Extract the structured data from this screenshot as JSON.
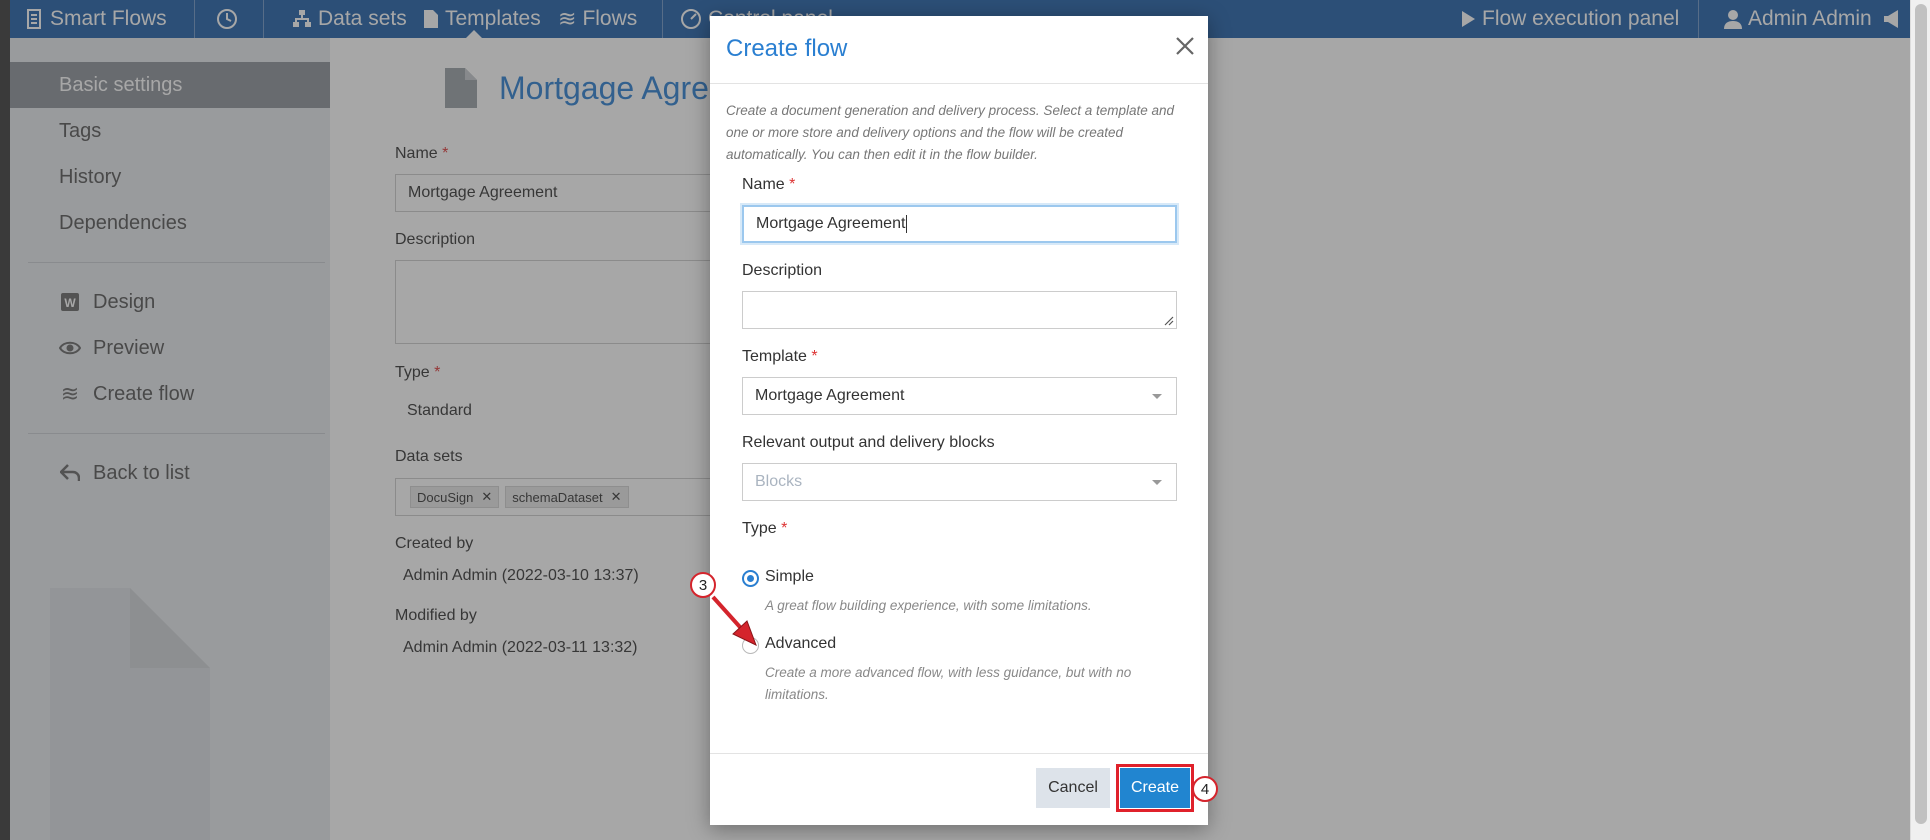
{
  "topbar": {
    "brand": "Smart Flows",
    "datasets": "Data sets",
    "templates": "Templates",
    "flows": "Flows",
    "control_panel": "Control panel",
    "flow_execution": "Flow execution panel",
    "user": "Admin Admin"
  },
  "sidebar": {
    "items": [
      {
        "label": "Basic settings"
      },
      {
        "label": "Tags"
      },
      {
        "label": "History"
      },
      {
        "label": "Dependencies"
      },
      {
        "label": "Design"
      },
      {
        "label": "Preview"
      },
      {
        "label": "Create flow"
      },
      {
        "label": "Back to list"
      }
    ]
  },
  "page": {
    "title": "Mortgage Agreement",
    "name_label": "Name",
    "name_value": "Mortgage Agreement",
    "description_label": "Description",
    "type_label": "Type",
    "type_value": "Standard",
    "datasets_label": "Data sets",
    "tags": [
      "DocuSign",
      "schemaDataset"
    ],
    "created_by_label": "Created by",
    "created_by_value": "Admin Admin (2022-03-10 13:37)",
    "modified_by_label": "Modified by",
    "modified_by_value": "Admin Admin (2022-03-11 13:32)"
  },
  "modal": {
    "title": "Create flow",
    "intro": "Create a document generation and delivery process. Select a template and one or more store and delivery options and the flow will be created automatically. You can then edit it in the flow builder.",
    "name_label": "Name",
    "name_value": "Mortgage Agreement",
    "description_label": "Description",
    "template_label": "Template",
    "template_value": "Mortgage Agreement",
    "blocks_label": "Relevant output and delivery blocks",
    "blocks_placeholder": "Blocks",
    "type_label": "Type",
    "simple_label": "Simple",
    "simple_desc": "A great flow building experience, with some limitations.",
    "advanced_label": "Advanced",
    "advanced_desc": "Create a more advanced flow, with less guidance, but with no limitations.",
    "cancel_label": "Cancel",
    "create_label": "Create",
    "required_mark": "*"
  },
  "annotations": {
    "step3": "3",
    "step4": "4"
  },
  "colors": {
    "topbar": "#1f5fa8",
    "accent": "#2a7fd1",
    "primary_button": "#2185d0",
    "highlight": "#e0212b"
  }
}
